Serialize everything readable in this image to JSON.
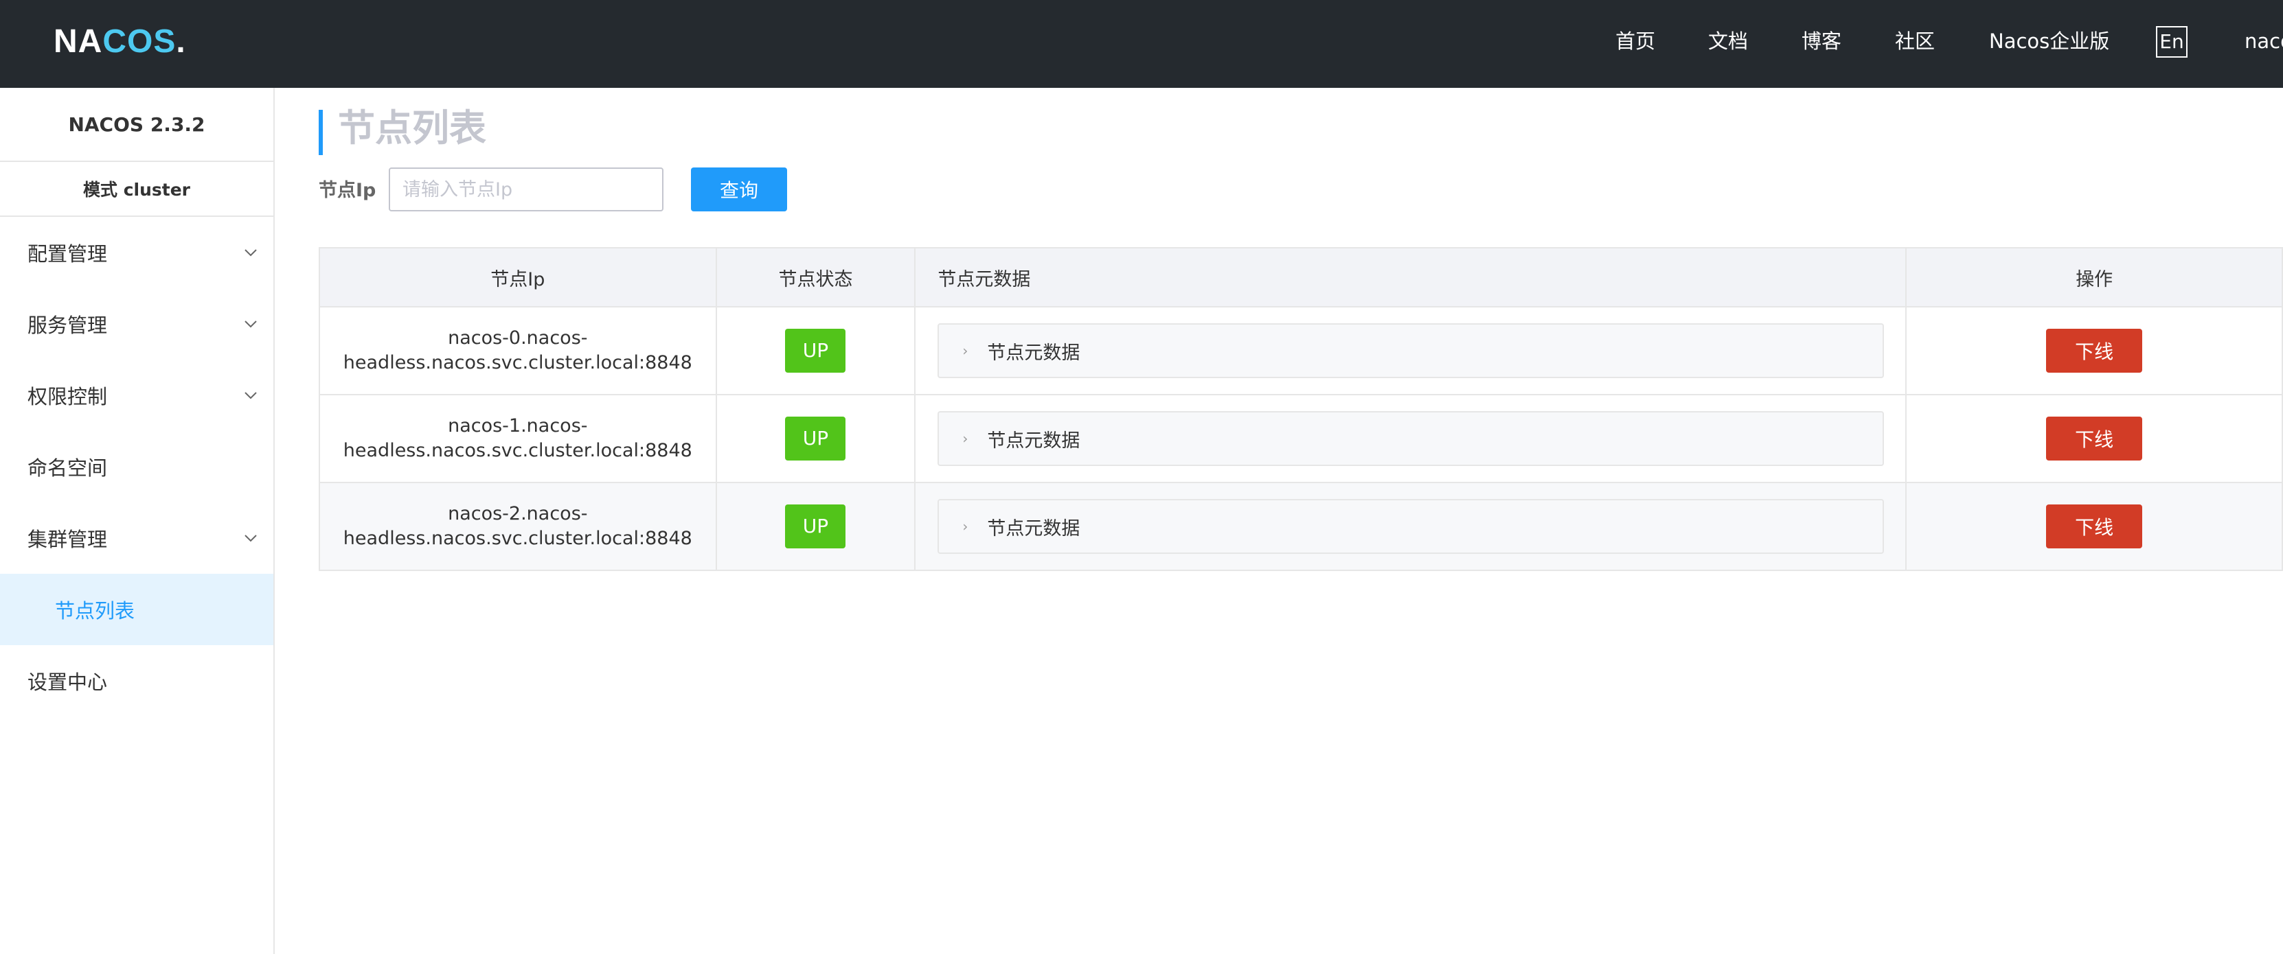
{
  "header": {
    "logo": {
      "part1": "NA",
      "part2": "COS",
      "part3": "."
    },
    "nav": [
      {
        "label": "首页"
      },
      {
        "label": "文档"
      },
      {
        "label": "博客"
      },
      {
        "label": "社区"
      },
      {
        "label": "Nacos企业版"
      }
    ],
    "lang": "En",
    "user": "naco"
  },
  "sidebar": {
    "version": "NACOS 2.3.2",
    "mode": "模式 cluster",
    "items": [
      {
        "label": "配置管理",
        "expandable": true
      },
      {
        "label": "服务管理",
        "expandable": true
      },
      {
        "label": "权限控制",
        "expandable": true
      },
      {
        "label": "命名空间",
        "expandable": false
      },
      {
        "label": "集群管理",
        "expandable": true
      },
      {
        "label": "节点列表",
        "sub": true,
        "active": true
      },
      {
        "label": "设置中心",
        "expandable": false
      }
    ]
  },
  "main": {
    "title": "节点列表",
    "filter_label": "节点Ip",
    "filter_placeholder": "请输入节点Ip",
    "search_label": "查询",
    "columns": [
      "节点Ip",
      "节点状态",
      "节点元数据",
      "操作"
    ],
    "rows": [
      {
        "ip_line1": "nacos-0.nacos-",
        "ip_line2": "headless.nacos.svc.cluster.local:8848",
        "status": "UP",
        "metadata": "节点元数据",
        "action": "下线"
      },
      {
        "ip_line1": "nacos-1.nacos-",
        "ip_line2": "headless.nacos.svc.cluster.local:8848",
        "status": "UP",
        "metadata": "节点元数据",
        "action": "下线"
      },
      {
        "ip_line1": "nacos-2.nacos-",
        "ip_line2": "headless.nacos.svc.cluster.local:8848",
        "status": "UP",
        "metadata": "节点元数据",
        "action": "下线"
      }
    ]
  },
  "colors": {
    "header_bg": "#252a2f",
    "accent": "#209bfa",
    "status_up": "#52c41a",
    "danger": "#d23c26"
  }
}
